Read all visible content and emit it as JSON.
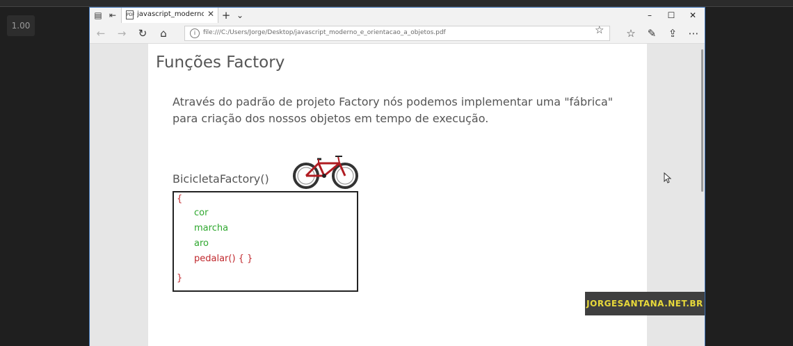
{
  "overlay": {
    "speed_badge": "1.00",
    "watermark": "JORGESANTANA.NET.BR"
  },
  "browser": {
    "tab_title": "javascript_moderno_e_c",
    "url": "file:///C:/Users/Jorge/Desktop/javascript_moderno_e_orientacao_a_objetos.pdf",
    "icons": [
      "tab-manager-icon",
      "set-aside-tabs-icon",
      "pdf-doc-icon",
      "new-tab-icon",
      "tab-list-chevron-icon",
      "back-icon",
      "forward-icon",
      "refresh-icon",
      "home-icon",
      "info-icon",
      "favorite-star-icon",
      "favorites-icon",
      "pen-icon",
      "share-icon",
      "more-icon"
    ]
  },
  "document": {
    "title": "Funções Factory",
    "paragraph": "Através do padrão de projeto Factory nós podemos implementar uma \"fábrica\" para criação dos nossos objetos em tempo de execução.",
    "factory_label": "BicicletaFactory()",
    "code": {
      "open_brace": "{",
      "lines": [
        "cor",
        "marcha",
        "aro",
        "pedalar() {  }"
      ],
      "close_brace": "}"
    }
  },
  "colors": {
    "code_property": "#2fa82f",
    "code_method": "#c0282d",
    "watermark_text": "#e8d93a"
  }
}
